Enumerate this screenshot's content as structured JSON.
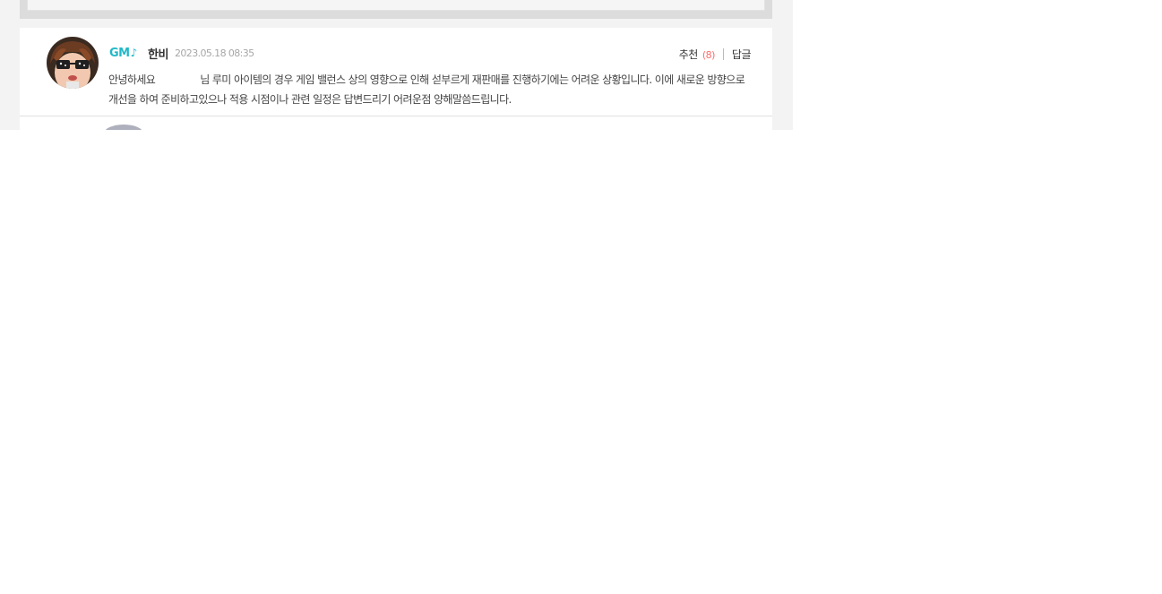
{
  "comment": {
    "badge": {
      "g": "GM",
      "icon": "music-note-icon",
      "note": "♪"
    },
    "author": "한비",
    "date": "2023.05.18 08:35",
    "recommend_label": "추천",
    "recommend_count": "(8)",
    "reply_label": "답글",
    "body_greeting": "안녕하세요",
    "body_rest": "님 루미 아이템의 경우 게임 밸런스 상의 영향으로 인해 섣부르게 재판매를 진행하기에는 어려운 상황입니다. 이에 새로운 방향으로 개선을 하여 준비하고있으나 적용 시점이나 관련 일정은 답변드리기 어려운점 양해말씀드립니다."
  },
  "colors": {
    "gm_cyan": "#22b8c8",
    "gm_pink": "#ff4f79",
    "recommend_count": "#ff6b6b",
    "date_gray": "#a7a7a7"
  }
}
